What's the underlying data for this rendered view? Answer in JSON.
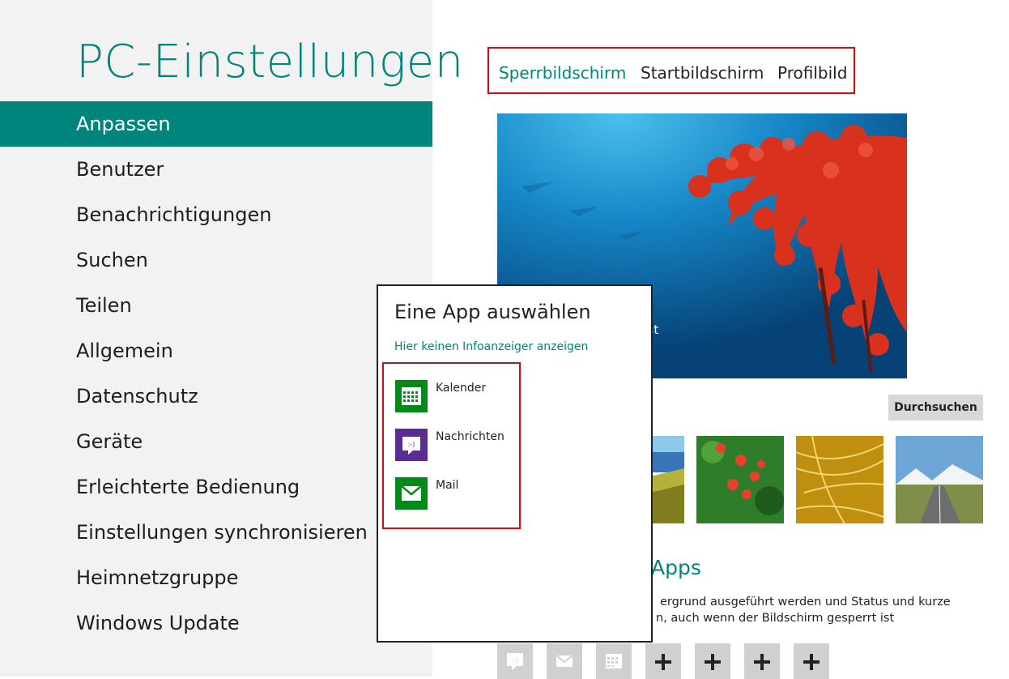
{
  "settings_title": "PC-Einstellungen",
  "nav": [
    {
      "label": "Anpassen"
    },
    {
      "label": "Benutzer"
    },
    {
      "label": "Benachrichtigungen"
    },
    {
      "label": "Suchen"
    },
    {
      "label": "Teilen"
    },
    {
      "label": "Allgemein"
    },
    {
      "label": "Datenschutz"
    },
    {
      "label": "Geräte"
    },
    {
      "label": "Erleichterte Bedienung"
    },
    {
      "label": "Einstellungen synchronisieren"
    },
    {
      "label": "Heimnetzgruppe"
    },
    {
      "label": "Windows Update"
    }
  ],
  "active_nav": "Anpassen",
  "tabs": [
    {
      "label": "Sperrbildschirm"
    },
    {
      "label": "Startbildschirm"
    },
    {
      "label": "Profilbild"
    }
  ],
  "active_tab": "Sperrbildschirm",
  "preview": {
    "partial_text": "ust"
  },
  "browse_label": "Durchsuchen",
  "apps_section": {
    "heading": "Apps",
    "desc_line1": "ergrund ausgeführt werden und Status und kurze",
    "desc_line2": "n, auch wenn der Bildschirm gesperrt ist"
  },
  "lock_apps": [
    {
      "icon": "messaging-icon"
    },
    {
      "icon": "mail-icon"
    },
    {
      "icon": "calendar-icon"
    },
    {
      "icon": "plus-icon"
    },
    {
      "icon": "plus-icon"
    },
    {
      "icon": "plus-icon"
    },
    {
      "icon": "plus-icon"
    }
  ],
  "picker": {
    "title": "Eine App auswählen",
    "none_link": "Hier keinen Infoanzeiger anzeigen",
    "apps": [
      {
        "label": "Kalender",
        "icon": "calendar-icon",
        "color": "#008a17"
      },
      {
        "label": "Nachrichten",
        "icon": "messaging-icon",
        "color": "#5c2d91"
      },
      {
        "label": "Mail",
        "icon": "mail-icon",
        "color": "#008a17"
      }
    ]
  },
  "colors": {
    "accent": "#00857c",
    "highlight_border": "#c0141b"
  }
}
